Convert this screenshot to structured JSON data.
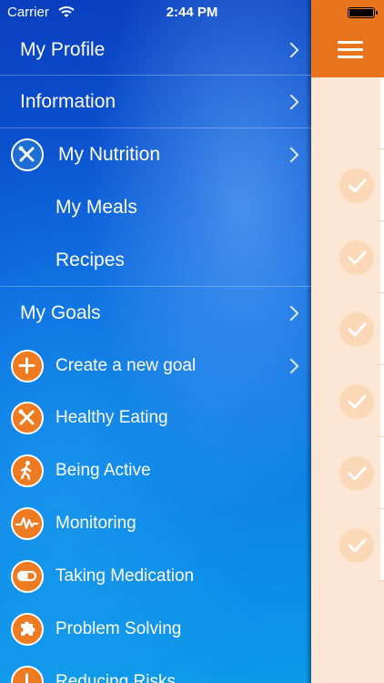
{
  "status_bar": {
    "carrier": "Carrier",
    "time": "2:44 PM"
  },
  "menu": {
    "my_profile": "My Profile",
    "information": "Information",
    "my_nutrition": "My Nutrition",
    "my_meals": "My Meals",
    "recipes": "Recipes",
    "my_goals": "My Goals",
    "goals": [
      {
        "label": "Create a new goal",
        "icon": "plus-icon"
      },
      {
        "label": "Healthy Eating",
        "icon": "fork-knife-icon"
      },
      {
        "label": "Being Active",
        "icon": "walking-person-icon"
      },
      {
        "label": "Monitoring",
        "icon": "pulse-line-icon"
      },
      {
        "label": "Taking Medication",
        "icon": "pill-icon"
      },
      {
        "label": "Problem Solving",
        "icon": "puzzle-icon"
      },
      {
        "label": "Reducing Risks",
        "icon": "warning-icon"
      }
    ]
  },
  "colors": {
    "accent": "#e8741e",
    "menu_blue": "#0b5bd8",
    "panel_bg": "#fde6d3"
  }
}
